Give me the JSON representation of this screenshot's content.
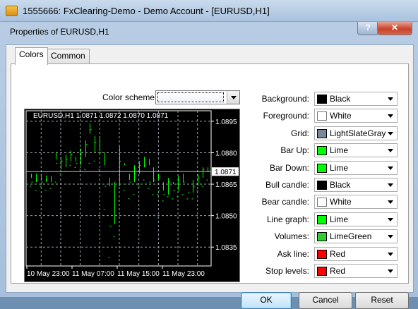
{
  "window": {
    "title": "1555666: FxClearing-Demo - Demo Account - [EURUSD,H1]"
  },
  "dialog": {
    "title": "Properties of EURUSD,H1",
    "help_label": "?",
    "close_label": "✕",
    "tabs": [
      {
        "label": "Colors"
      },
      {
        "label": "Common"
      }
    ],
    "color_scheme_label": "Color scheme:",
    "buttons": {
      "ok": "OK",
      "cancel": "Cancel",
      "reset": "Reset"
    }
  },
  "colors": [
    {
      "label": "Background:",
      "value": "Black",
      "swatch": "#000000"
    },
    {
      "label": "Foreground:",
      "value": "White",
      "swatch": "#ffffff"
    },
    {
      "label": "Grid:",
      "value": "LightSlateGray",
      "swatch": "#778899"
    },
    {
      "label": "Bar Up:",
      "value": "Lime",
      "swatch": "#00ff00"
    },
    {
      "label": "Bar Down:",
      "value": "Lime",
      "swatch": "#00ff00"
    },
    {
      "label": "Bull candle:",
      "value": "Black",
      "swatch": "#000000"
    },
    {
      "label": "Bear candle:",
      "value": "White",
      "swatch": "#ffffff"
    },
    {
      "label": "Line graph:",
      "value": "Lime",
      "swatch": "#00ff00"
    },
    {
      "label": "Volumes:",
      "value": "LimeGreen",
      "swatch": "#32cd32"
    },
    {
      "label": "Ask line:",
      "value": "Red",
      "swatch": "#ff0000"
    },
    {
      "label": "Stop levels:",
      "value": "Red",
      "swatch": "#ff0000"
    }
  ],
  "chart_data": {
    "type": "bar",
    "title": "EURUSD,H1  1.0871 1.0872 1.0870 1.0871",
    "y_ticks": [
      "1.0895",
      "1.0880",
      "1.0865",
      "1.0850",
      "1.0835"
    ],
    "y_tick_values": [
      1.0895,
      1.088,
      1.0865,
      1.085,
      1.0835
    ],
    "current_price": "1.0871",
    "current_value": 1.0871,
    "x_ticks": [
      "10 May 23:00",
      "11 May 07:00",
      "11 May 15:00",
      "11 May 23:00"
    ],
    "ylim": [
      1.0826,
      1.09
    ],
    "grid": true,
    "bars": [
      [
        1.0864,
        1.087,
        1.0868,
        1.0866
      ],
      [
        1.0862,
        1.087,
        1.0866,
        1.0867
      ],
      [
        1.0864,
        1.087,
        1.0867,
        1.0866
      ],
      [
        1.0862,
        1.0869,
        1.0866,
        1.0867
      ],
      [
        1.0863,
        1.0869,
        1.0866,
        1.0865
      ],
      [
        1.0866,
        1.088,
        1.0877,
        1.0875
      ],
      [
        1.087,
        1.0878,
        1.0872,
        1.0876
      ],
      [
        1.0871,
        1.0879,
        1.0873,
        1.0877
      ],
      [
        1.0874,
        1.0881,
        1.0876,
        1.0879
      ],
      [
        1.0873,
        1.0878,
        1.0876,
        1.0875
      ],
      [
        1.0872,
        1.0882,
        1.0874,
        1.0879
      ],
      [
        1.0872,
        1.0886,
        1.0878,
        1.0884
      ],
      [
        1.0875,
        1.0894,
        1.0889,
        1.0891
      ],
      [
        1.0876,
        1.0888,
        1.088,
        1.0885
      ],
      [
        1.0872,
        1.0888,
        1.0881,
        1.088
      ],
      [
        1.0853,
        1.088,
        1.0874,
        1.0864
      ],
      [
        1.083,
        1.0868,
        1.0864,
        1.0845
      ],
      [
        1.084,
        1.0866,
        1.0846,
        1.0864
      ],
      [
        1.0857,
        1.0883,
        1.0864,
        1.0876
      ],
      [
        1.0862,
        1.0875,
        1.0874,
        1.0865
      ],
      [
        1.0858,
        1.087,
        1.0867,
        1.0866
      ],
      [
        1.086,
        1.0874,
        1.0866,
        1.087
      ],
      [
        1.0864,
        1.0876,
        1.087,
        1.0874
      ],
      [
        1.0867,
        1.0878,
        1.0873,
        1.0874
      ],
      [
        1.0863,
        1.0877,
        1.0874,
        1.0866
      ],
      [
        1.086,
        1.0873,
        1.0866,
        1.0867
      ],
      [
        1.086,
        1.087,
        1.0867,
        1.0862
      ],
      [
        1.0857,
        1.0866,
        1.0862,
        1.086
      ],
      [
        1.0859,
        1.0868,
        1.086,
        1.0866
      ],
      [
        1.0858,
        1.0866,
        1.0865,
        1.0862
      ],
      [
        1.0859,
        1.0869,
        1.0862,
        1.0867
      ],
      [
        1.086,
        1.087,
        1.0866,
        1.0866
      ],
      [
        1.0858,
        1.0866,
        1.0866,
        1.0861
      ],
      [
        1.0858,
        1.0867,
        1.0861,
        1.0864
      ],
      [
        1.0862,
        1.087,
        1.0864,
        1.0868
      ],
      [
        1.0864,
        1.0873,
        1.0868,
        1.0872
      ],
      [
        1.0867,
        1.0873,
        1.0871,
        1.0871
      ]
    ]
  }
}
